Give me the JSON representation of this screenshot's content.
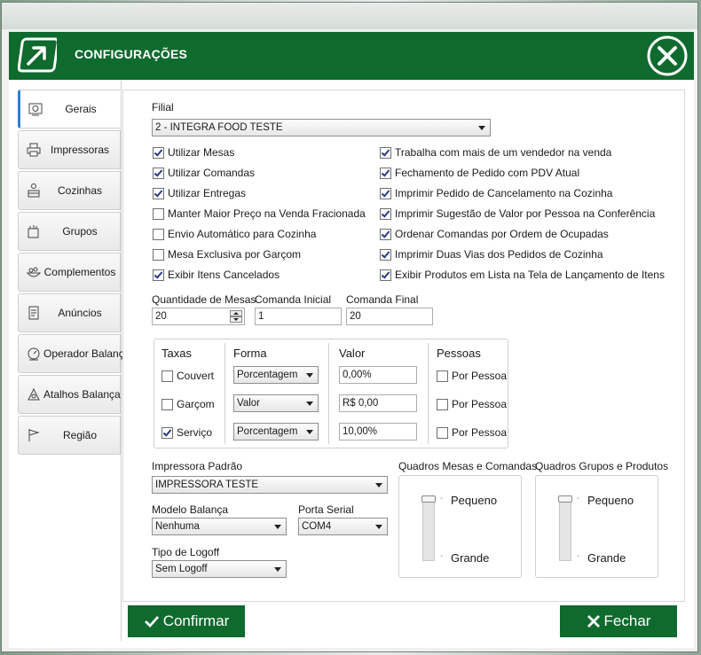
{
  "window": {
    "title": "CONFIGURAÇÕES"
  },
  "colors": {
    "header": "#0f6a2e",
    "accent_tab": "#2f7fd6"
  },
  "sidebar": {
    "items": [
      {
        "label": "Gerais",
        "icon": "settings-panel-icon",
        "active": true
      },
      {
        "label": "Impressoras",
        "icon": "printer-icon"
      },
      {
        "label": "Cozinhas",
        "icon": "kitchen-icon"
      },
      {
        "label": "Grupos",
        "icon": "groups-icon"
      },
      {
        "label": "Complementos",
        "icon": "dish-icon"
      },
      {
        "label": "Anúncios",
        "icon": "document-icon"
      },
      {
        "label": "Operador  Balança",
        "icon": "scale-icon"
      },
      {
        "label": "Atalhos Balança",
        "icon": "scale-shortcut-icon"
      },
      {
        "label": "Região",
        "icon": "flag-icon"
      }
    ]
  },
  "filial": {
    "label": "Filial",
    "value": "2 - INTEGRA FOOD TESTE"
  },
  "options_left": [
    {
      "label": "Utilizar Mesas",
      "checked": true
    },
    {
      "label": "Utilizar Comandas",
      "checked": true
    },
    {
      "label": "Utilizar Entregas",
      "checked": true
    },
    {
      "label": "Manter Maior Preço na Venda Fracionada",
      "checked": false
    },
    {
      "label": "Envio Automático para Cozinha",
      "checked": false
    },
    {
      "label": "Mesa Exclusiva por Garçom",
      "checked": false
    },
    {
      "label": "Exibir Itens Cancelados",
      "checked": true
    }
  ],
  "options_right": [
    {
      "label": "Trabalha com mais de um vendedor na venda",
      "checked": true
    },
    {
      "label": "Fechamento de Pedido com PDV Atual",
      "checked": true
    },
    {
      "label": "Imprimir Pedido de Cancelamento na Cozinha",
      "checked": true
    },
    {
      "label": "Imprimir Sugestão de Valor por Pessoa na Conferência",
      "checked": true
    },
    {
      "label": "Ordenar Comandas por Ordem de Ocupadas",
      "checked": true
    },
    {
      "label": "Imprimir Duas Vias dos Pedidos de Cozinha",
      "checked": true
    },
    {
      "label": "Exibir Produtos em Lista na Tela de Lançamento de Itens",
      "checked": true
    }
  ],
  "quantities": {
    "mesas_label": "Quantidade de Mesas",
    "mesas_value": "20",
    "comanda_inicial_label": "Comanda Inicial",
    "comanda_inicial_value": "1",
    "comanda_final_label": "Comanda Final",
    "comanda_final_value": "20"
  },
  "taxas": {
    "headers": {
      "taxas": "Taxas",
      "forma": "Forma",
      "valor": "Valor",
      "pessoas": "Pessoas"
    },
    "rows": [
      {
        "label": "Couvert",
        "checked": false,
        "forma": "Porcentagem",
        "valor": "0,00%",
        "pessoa_label": "Por Pessoa",
        "pessoa_checked": false
      },
      {
        "label": "Garçom",
        "checked": false,
        "forma": "Valor",
        "valor": "R$ 0,00",
        "pessoa_label": "Por Pessoa",
        "pessoa_checked": false
      },
      {
        "label": "Serviço",
        "checked": true,
        "forma": "Porcentagem",
        "valor": "10,00%",
        "pessoa_label": "Por Pessoa",
        "pessoa_checked": false
      }
    ]
  },
  "impressora": {
    "label": "Impressora Padrão",
    "value": "IMPRESSORA TESTE"
  },
  "balanca": {
    "label": "Modelo Balança",
    "value": "Nenhuma"
  },
  "porta": {
    "label": "Porta Serial",
    "value": "COM4"
  },
  "logoff": {
    "label": "Tipo de Logoff",
    "value": "Sem Logoff"
  },
  "quadros_mesas": {
    "label": "Quadros Mesas e Comandas",
    "min_label": "Pequeno",
    "max_label": "Grande",
    "level": 0
  },
  "quadros_grupos": {
    "label": "Quadros Grupos e Produtos",
    "min_label": "Pequeno",
    "max_label": "Grande",
    "level": 0
  },
  "footer": {
    "confirm_label": "Confirmar",
    "close_label": "Fechar"
  }
}
